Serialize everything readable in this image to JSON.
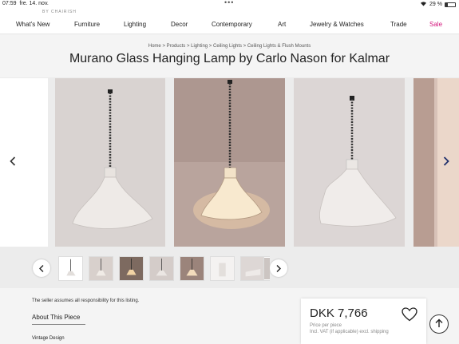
{
  "status": {
    "time": "07:59",
    "date": "fre. 14. nov.",
    "battery": "29 %",
    "battery_level": 0.29
  },
  "brand": "BY CHAIRISH",
  "nav": [
    {
      "label": "What's New"
    },
    {
      "label": "Furniture"
    },
    {
      "label": "Lighting"
    },
    {
      "label": "Decor"
    },
    {
      "label": "Contemporary"
    },
    {
      "label": "Art"
    },
    {
      "label": "Jewelry & Watches"
    },
    {
      "label": "Trade"
    },
    {
      "label": "Sale"
    }
  ],
  "breadcrumb": "Home > Products > Lighting > Ceiling Lights > Ceiling Lights & Flush Mounts",
  "product": {
    "title": "Murano Glass Hanging Lamp by Carlo Nason for Kalmar",
    "price": "DKK 7,766",
    "price_note": "Price per piece",
    "vat_note": "Incl. VAT (if applicable) excl. shipping"
  },
  "carousel": {
    "prev_icon": "chevron-left-icon",
    "next_icon": "chevron-right-icon"
  },
  "thumbnails": {
    "count": 8
  },
  "seller_notice": "The seller assumes all responsibility for this listing.",
  "about_heading": "About This Piece",
  "section_heading": "Vintage Design",
  "colors": {
    "sale": "#d4147c",
    "next_arrow": "#1f2f6b"
  }
}
